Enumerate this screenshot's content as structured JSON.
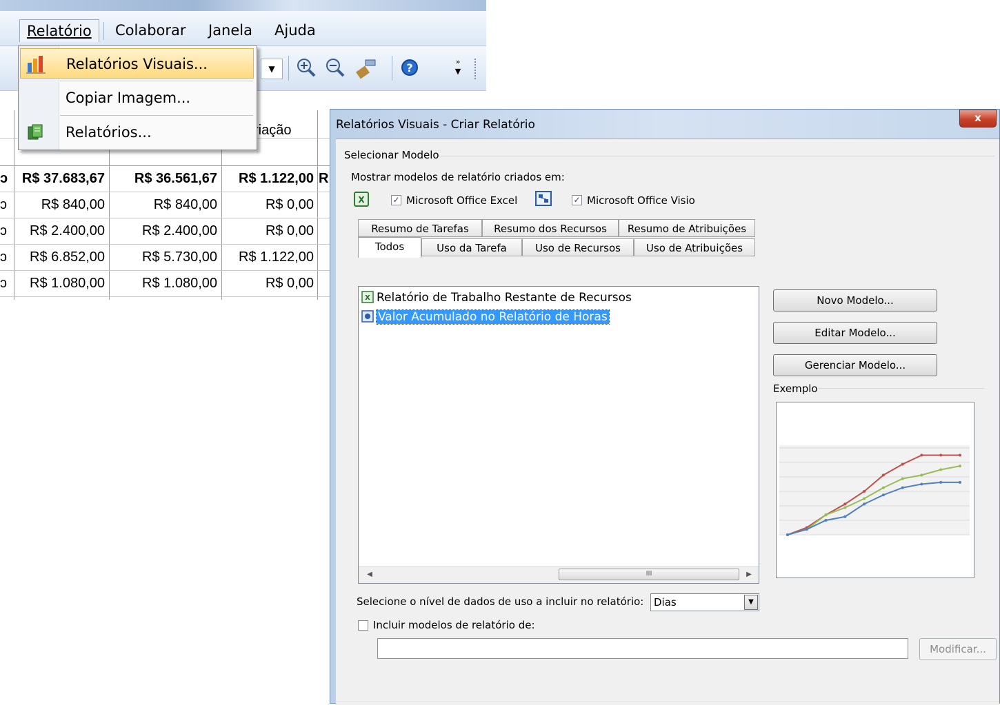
{
  "menubar": {
    "items": [
      "Relatório",
      "Colaborar",
      "Janela",
      "Ajuda"
    ]
  },
  "menu_dropdown": {
    "items": [
      {
        "label": "Relatórios Visuais...",
        "icon": "chart-bar-icon"
      },
      {
        "label": "Copiar Imagem...",
        "icon": ""
      },
      {
        "label": "Relatórios...",
        "icon": "reports-book-icon"
      }
    ]
  },
  "toolbar": {
    "icons": [
      "dropdown-arrow-icon",
      "zoom-in-icon",
      "zoom-out-icon",
      "format-painter-icon",
      "help-icon",
      "toolbar-options-icon"
    ]
  },
  "grid": {
    "header_partial": "riação",
    "rows": [
      [
        "R$ 37.683,67",
        "R$ 36.561,67",
        "R$ 1.122,00",
        "R"
      ],
      [
        "R$ 840,00",
        "R$ 840,00",
        "R$ 0,00",
        ""
      ],
      [
        "R$ 2.400,00",
        "R$ 2.400,00",
        "R$ 0,00",
        ""
      ],
      [
        "R$ 6.852,00",
        "R$ 5.730,00",
        "R$ 1.122,00",
        ""
      ],
      [
        "R$ 1.080,00",
        "R$ 1.080,00",
        "R$ 0,00",
        ""
      ]
    ]
  },
  "dialog": {
    "title": "Relatórios Visuais - Criar Relatório",
    "close_label": "x",
    "group_select": "Selecionar Modelo",
    "show_label": "Mostrar modelos de relatório criados em:",
    "excel_checkbox": {
      "label": "Microsoft Office Excel",
      "checked": true
    },
    "visio_checkbox": {
      "label": "Microsoft Office Visio",
      "checked": true
    },
    "tabs_row1": [
      "Resumo de Tarefas",
      "Resumo dos Recursos",
      "Resumo de Atribuições"
    ],
    "tabs_row2": [
      "Todos",
      "Uso da Tarefa",
      "Uso de Recursos",
      "Uso de Atribuições"
    ],
    "active_tab": "Todos",
    "templates": [
      {
        "label": "Relatório de Trabalho Restante de Recursos",
        "type": "excel",
        "selected": false
      },
      {
        "label": "Valor Acumulado no Relatório de Horas",
        "type": "visio",
        "selected": true
      }
    ],
    "scroll_grip": "III",
    "buttons": {
      "new": "Novo Modelo...",
      "edit": "Editar Modelo...",
      "manage": "Gerenciar Modelo...",
      "modify": "Modificar..."
    },
    "example_label": "Exemplo",
    "usage_label": "Selecione o nível de dados de uso a incluir no relatório:",
    "usage_value": "Dias",
    "include_label": "Incluir modelos de relatório de:",
    "include_checked": false,
    "include_path": ""
  },
  "preview_chart": {
    "series": [
      {
        "color": "#c0504d",
        "values": [
          0,
          4,
          11,
          17,
          24,
          33,
          39,
          44,
          44,
          44
        ]
      },
      {
        "color": "#9bbb59",
        "values": [
          0,
          3,
          11,
          15,
          20,
          26,
          31,
          33,
          36,
          38
        ]
      },
      {
        "color": "#4f81bd",
        "values": [
          0,
          3,
          8,
          10,
          17,
          22,
          26,
          28,
          29,
          29
        ]
      }
    ]
  }
}
